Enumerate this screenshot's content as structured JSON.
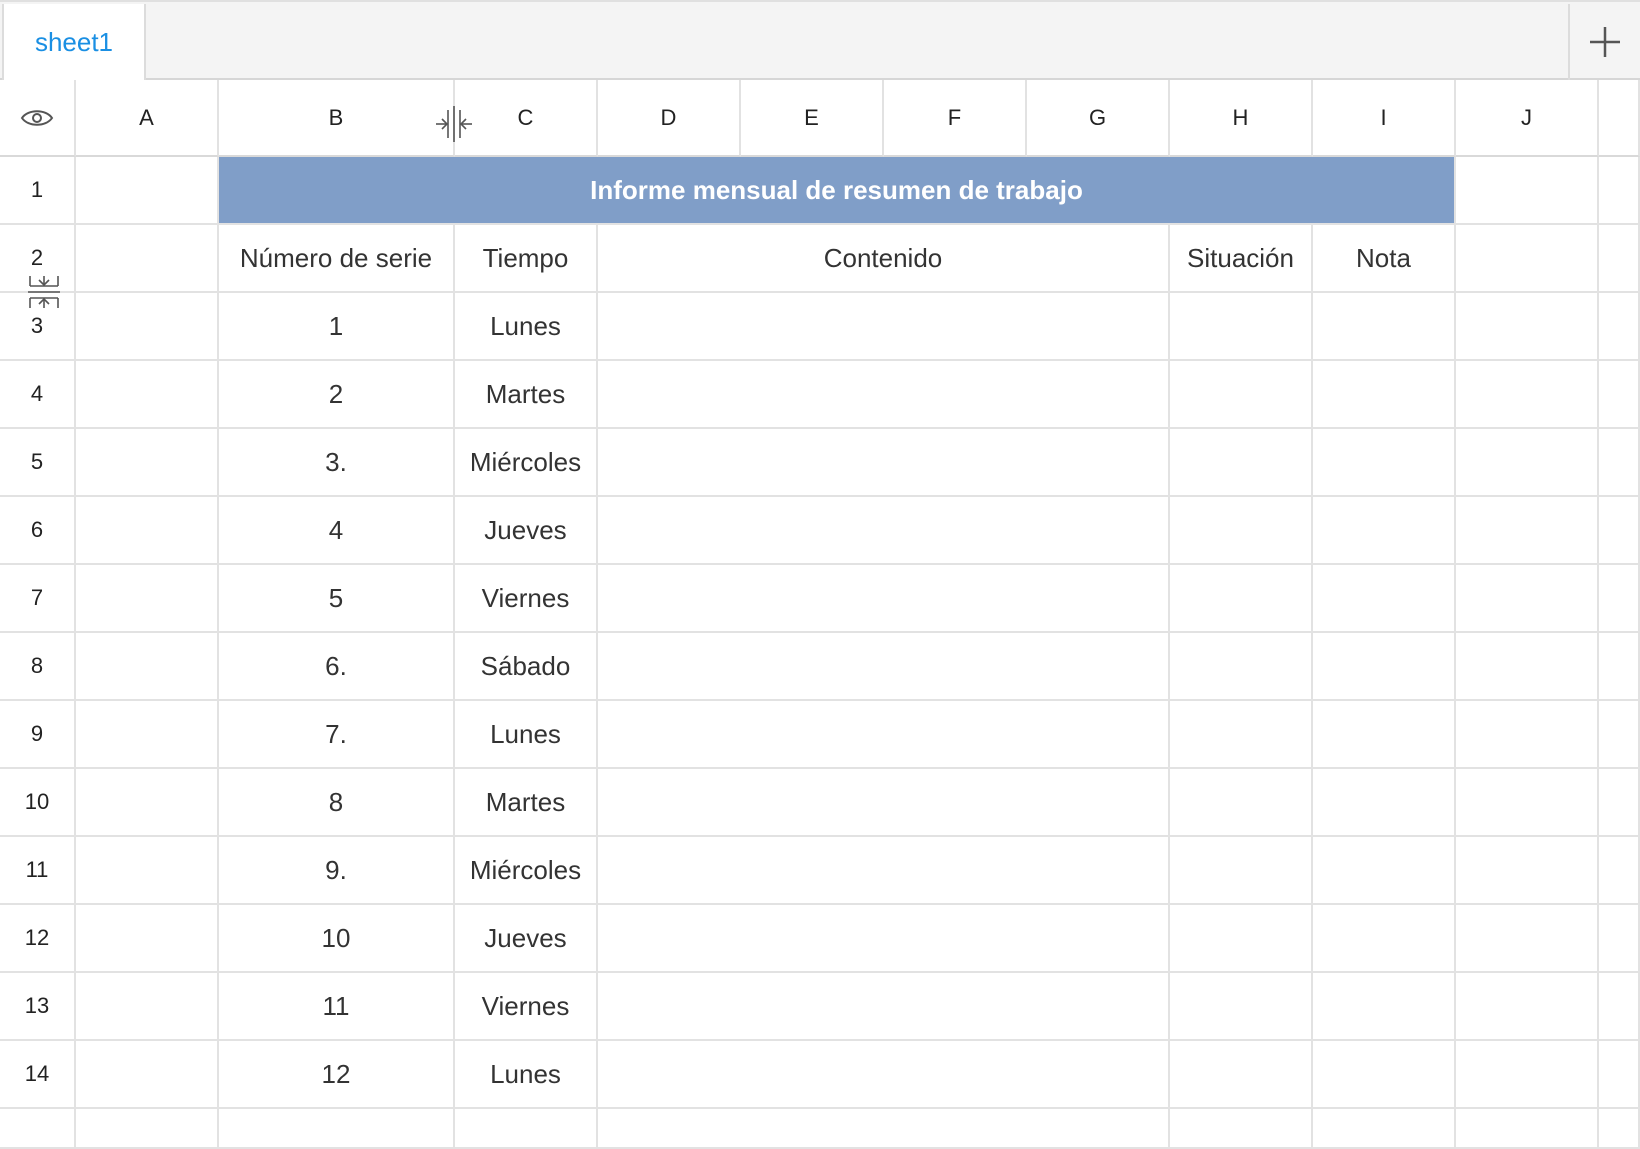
{
  "tabs": {
    "sheet_label": "sheet1"
  },
  "columns": [
    "A",
    "B",
    "C",
    "D",
    "E",
    "F",
    "G",
    "H",
    "I",
    "J"
  ],
  "rows": [
    "1",
    "2",
    "3",
    "4",
    "5",
    "6",
    "7",
    "8",
    "9",
    "10",
    "11",
    "12",
    "13",
    "14"
  ],
  "title": "Informe mensual de resumen de trabajo",
  "headers": {
    "serial": "Número de serie",
    "time": "Tiempo",
    "content": "Contenido",
    "status": "Situación",
    "note": "Nota"
  },
  "data_rows": [
    {
      "serial": "1",
      "time": "Lunes"
    },
    {
      "serial": "2",
      "time": "Martes"
    },
    {
      "serial": "3.",
      "time": "Miércoles"
    },
    {
      "serial": "4",
      "time": "Jueves"
    },
    {
      "serial": "5",
      "time": "Viernes"
    },
    {
      "serial": "6.",
      "time": "Sábado"
    },
    {
      "serial": "7.",
      "time": "Lunes"
    },
    {
      "serial": "8",
      "time": "Martes"
    },
    {
      "serial": "9.",
      "time": "Miércoles"
    },
    {
      "serial": "10",
      "time": "Jueves"
    },
    {
      "serial": "11",
      "time": "Viernes"
    },
    {
      "serial": "12",
      "time": "Lunes"
    }
  ],
  "icons": {
    "visibility": "eye-icon",
    "add_sheet": "plus-icon",
    "col_resize": "column-resize-icon",
    "row_resize": "row-resize-icon"
  },
  "colors": {
    "title_bg": "#809ec8",
    "tab_text": "#1a8fe3"
  }
}
